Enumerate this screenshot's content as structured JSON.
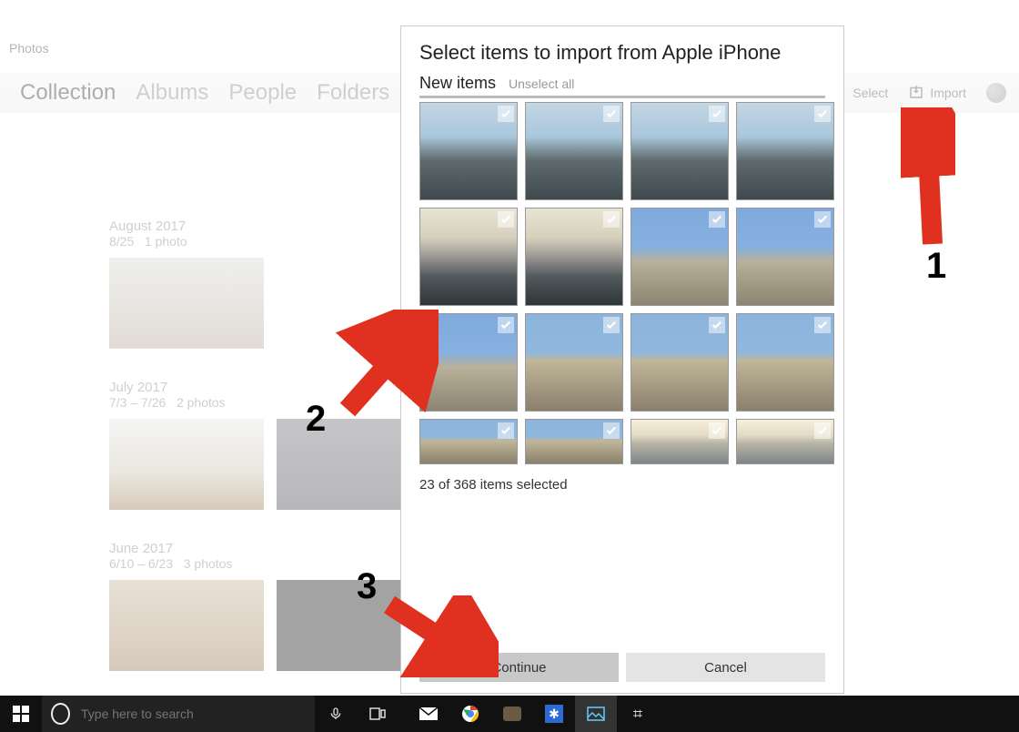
{
  "window": {
    "title": "Photos"
  },
  "nav": {
    "tabs": [
      {
        "label": "Collection",
        "active": true
      },
      {
        "label": "Albums"
      },
      {
        "label": "People"
      },
      {
        "label": "Folders"
      }
    ]
  },
  "topbar": {
    "select_label": "Select",
    "import_label": "Import"
  },
  "collection_groups": [
    {
      "title": "August 2017",
      "sub_date": "8/25",
      "sub_count": "1 photo",
      "photos": 1
    },
    {
      "title": "July 2017",
      "sub_date": "7/3 – 7/26",
      "sub_count": "2 photos",
      "photos": 2
    },
    {
      "title": "June 2017",
      "sub_date": "6/10 – 6/23",
      "sub_count": "3 photos",
      "photos": 2
    }
  ],
  "dialog": {
    "title": "Select items to import from Apple iPhone",
    "new_items_label": "New items",
    "unselect_label": "Unselect all",
    "selected_text": "23 of 368 items selected",
    "continue_label": "Continue",
    "cancel_label": "Cancel",
    "thumbnails": {
      "full_rows": 3,
      "half_row": 1,
      "cols": 4
    }
  },
  "annotations": {
    "step1": "1",
    "step2": "2",
    "step3": "3"
  },
  "taskbar": {
    "search_placeholder": "Type here to search"
  }
}
